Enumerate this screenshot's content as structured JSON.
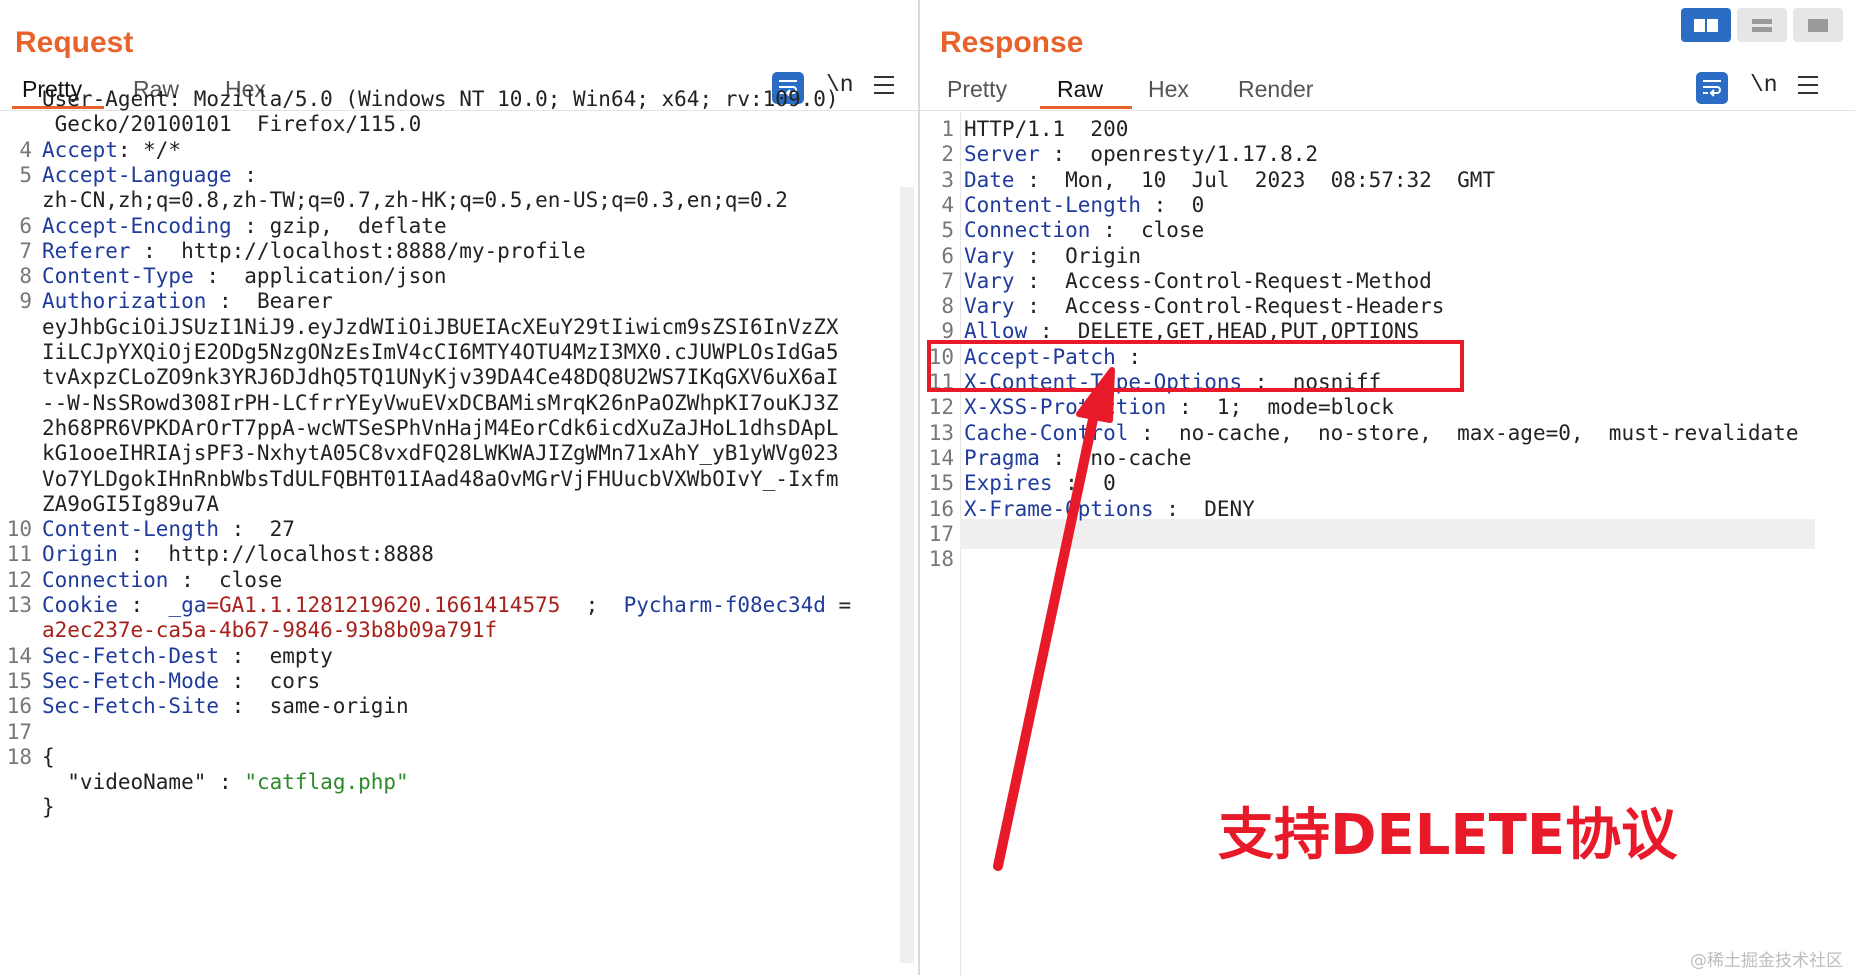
{
  "request": {
    "title": "Request",
    "tabs": [
      {
        "label": "Pretty",
        "active": true
      },
      {
        "label": "Raw",
        "active": false
      },
      {
        "label": "Hex",
        "active": false
      }
    ],
    "newline_label": "\\n",
    "lines": [
      {
        "n": "",
        "parts": [
          {
            "t": "User-Agent: Mozilla/5.0 (Windows NT 10.0; Win64; x64; rv:109.0)",
            "c": "v"
          }
        ]
      },
      {
        "n": "",
        "parts": [
          {
            "t": " Gecko/20100101  Firefox/115.0",
            "c": "v"
          }
        ]
      },
      {
        "n": "4",
        "parts": [
          {
            "t": "Accept",
            "c": "k"
          },
          {
            "t": ": */*",
            "c": "v"
          }
        ]
      },
      {
        "n": "5",
        "parts": [
          {
            "t": "Accept-Language",
            "c": "k"
          },
          {
            "t": " :",
            "c": "v"
          }
        ]
      },
      {
        "n": "",
        "parts": [
          {
            "t": "zh-CN,zh;q=0.8,zh-TW;q=0.7,zh-HK;q=0.5,en-US;q=0.3,en;q=0.2",
            "c": "v"
          }
        ]
      },
      {
        "n": "6",
        "parts": [
          {
            "t": "Accept-Encoding",
            "c": "k"
          },
          {
            "t": " : gzip,  deflate",
            "c": "v"
          }
        ]
      },
      {
        "n": "7",
        "parts": [
          {
            "t": "Referer",
            "c": "k"
          },
          {
            "t": " :  http://localhost:8888/my-profile",
            "c": "v"
          }
        ]
      },
      {
        "n": "8",
        "parts": [
          {
            "t": "Content-Type",
            "c": "k"
          },
          {
            "t": " :  application/json",
            "c": "v"
          }
        ]
      },
      {
        "n": "9",
        "parts": [
          {
            "t": "Authorization",
            "c": "k"
          },
          {
            "t": " :  Bearer",
            "c": "v"
          }
        ]
      },
      {
        "n": "",
        "parts": [
          {
            "t": "eyJhbGciOiJSUzI1NiJ9.eyJzdWIiOiJBUEIAcXEuY29tIiwicm9sZSI6InVzZX",
            "c": "v"
          }
        ]
      },
      {
        "n": "",
        "parts": [
          {
            "t": "IiLCJpYXQiOjE2ODg5NzgONzEsImV4cCI6MTY4OTU4MzI3MX0.cJUWPLOsIdGa5",
            "c": "v"
          }
        ]
      },
      {
        "n": "",
        "parts": [
          {
            "t": "tvAxpzCLoZO9nk3YRJ6DJdhQ5TQ1UNyKjv39DA4Ce48DQ8U2WS7IKqGXV6uX6aI",
            "c": "v"
          }
        ]
      },
      {
        "n": "",
        "parts": [
          {
            "t": "--W-NsSRowd308IrPH-LCfrrYEyVwuEVxDCBAMisMrqK26nPaOZWhpKI7ouKJ3Z",
            "c": "v"
          }
        ]
      },
      {
        "n": "",
        "parts": [
          {
            "t": "2h68PR6VPKDArOrT7ppA-wcWTSeSPhVnHajM4EorCdk6icdXuZaJHoL1dhsDApL",
            "c": "v"
          }
        ]
      },
      {
        "n": "",
        "parts": [
          {
            "t": "kG1ooeIHRIAjsPF3-NxhytA05C8vxdFQ28LWKWAJIZgWMn71xAhY_yB1yWVg023",
            "c": "v"
          }
        ]
      },
      {
        "n": "",
        "parts": [
          {
            "t": "Vo7YLDgokIHnRnbWbsTdULFQBHT01IAad48aOvMGrVjFHUucbVXWbOIvY_-Ixfm",
            "c": "v"
          }
        ]
      },
      {
        "n": "",
        "parts": [
          {
            "t": "ZA9oGI5Ig89u7A",
            "c": "v"
          }
        ]
      },
      {
        "n": "10",
        "parts": [
          {
            "t": "Content-Length",
            "c": "k"
          },
          {
            "t": " :  27",
            "c": "v"
          }
        ]
      },
      {
        "n": "11",
        "parts": [
          {
            "t": "Origin",
            "c": "k"
          },
          {
            "t": " :  http://localhost:8888",
            "c": "v"
          }
        ]
      },
      {
        "n": "12",
        "parts": [
          {
            "t": "Connection",
            "c": "k"
          },
          {
            "t": " :  close",
            "c": "v"
          }
        ]
      },
      {
        "n": "13",
        "parts": [
          {
            "t": "Cookie",
            "c": "k"
          },
          {
            "t": " :  ",
            "c": "v"
          },
          {
            "t": "_ga",
            "c": "k"
          },
          {
            "t": "=GA1.1.1281219620.1661414575",
            "c": "cookie-val"
          },
          {
            "t": "  ;  ",
            "c": "v"
          },
          {
            "t": "Pycharm-f08ec34d",
            "c": "k"
          },
          {
            "t": " =",
            "c": "v"
          }
        ]
      },
      {
        "n": "",
        "parts": [
          {
            "t": "a2ec237e-ca5a-4b67-9846-93b8b09a791f",
            "c": "cookie-val"
          }
        ]
      },
      {
        "n": "14",
        "parts": [
          {
            "t": "Sec-Fetch-Dest",
            "c": "k"
          },
          {
            "t": " :  empty",
            "c": "v"
          }
        ]
      },
      {
        "n": "15",
        "parts": [
          {
            "t": "Sec-Fetch-Mode",
            "c": "k"
          },
          {
            "t": " :  cors",
            "c": "v"
          }
        ]
      },
      {
        "n": "16",
        "parts": [
          {
            "t": "Sec-Fetch-Site",
            "c": "k"
          },
          {
            "t": " :  same-origin",
            "c": "v"
          }
        ]
      },
      {
        "n": "17",
        "parts": []
      },
      {
        "n": "18",
        "parts": [
          {
            "t": "{",
            "c": "v"
          }
        ]
      },
      {
        "n": "",
        "parts": [
          {
            "t": "  \"videoName\"",
            "c": "json-key"
          },
          {
            "t": " : ",
            "c": "v"
          },
          {
            "t": "\"catflag.php\"",
            "c": "json-str"
          }
        ]
      },
      {
        "n": "",
        "parts": [
          {
            "t": "}",
            "c": "v"
          }
        ]
      }
    ]
  },
  "response": {
    "title": "Response",
    "tabs": [
      {
        "label": "Pretty",
        "active": false
      },
      {
        "label": "Raw",
        "active": true
      },
      {
        "label": "Hex",
        "active": false
      },
      {
        "label": "Render",
        "active": false
      }
    ],
    "newline_label": "\\n",
    "lines": [
      {
        "n": "1",
        "parts": [
          {
            "t": "HTTP/1.1  200",
            "c": "v"
          }
        ]
      },
      {
        "n": "2",
        "parts": [
          {
            "t": "Server",
            "c": "k"
          },
          {
            "t": " :  openresty/1.17.8.2",
            "c": "v"
          }
        ]
      },
      {
        "n": "3",
        "parts": [
          {
            "t": "Date",
            "c": "k"
          },
          {
            "t": " :  Mon,  10  Jul  2023  08:57:32  GMT",
            "c": "v"
          }
        ]
      },
      {
        "n": "4",
        "parts": [
          {
            "t": "Content-Length",
            "c": "k"
          },
          {
            "t": " :  0",
            "c": "v"
          }
        ]
      },
      {
        "n": "5",
        "parts": [
          {
            "t": "Connection",
            "c": "k"
          },
          {
            "t": " :  close",
            "c": "v"
          }
        ]
      },
      {
        "n": "6",
        "parts": [
          {
            "t": "Vary",
            "c": "k"
          },
          {
            "t": " :  Origin",
            "c": "v"
          }
        ]
      },
      {
        "n": "7",
        "parts": [
          {
            "t": "Vary",
            "c": "k"
          },
          {
            "t": " :  Access-Control-Request-Method",
            "c": "v"
          }
        ]
      },
      {
        "n": "8",
        "parts": [
          {
            "t": "Vary",
            "c": "k"
          },
          {
            "t": " :  Access-Control-Request-Headers",
            "c": "v"
          }
        ]
      },
      {
        "n": "9",
        "parts": [
          {
            "t": "Allow",
            "c": "k"
          },
          {
            "t": " :  DELETE,GET,HEAD,PUT,OPTIONS",
            "c": "v"
          }
        ]
      },
      {
        "n": "10",
        "parts": [
          {
            "t": "Accept-Patch",
            "c": "k"
          },
          {
            "t": " :",
            "c": "v"
          }
        ]
      },
      {
        "n": "11",
        "parts": [
          {
            "t": "X-Content-Type-Options",
            "c": "k"
          },
          {
            "t": " :  nosniff",
            "c": "v"
          }
        ]
      },
      {
        "n": "12",
        "parts": [
          {
            "t": "X-XSS-Protection",
            "c": "k"
          },
          {
            "t": " :  1;  mode=block",
            "c": "v"
          }
        ]
      },
      {
        "n": "13",
        "parts": [
          {
            "t": "Cache-Control",
            "c": "k"
          },
          {
            "t": " :  no-cache,  no-store,  max-age=0,  must-revalidate",
            "c": "v"
          }
        ]
      },
      {
        "n": "14",
        "parts": [
          {
            "t": "Pragma",
            "c": "k"
          },
          {
            "t": " :  no-cache",
            "c": "v"
          }
        ]
      },
      {
        "n": "15",
        "parts": [
          {
            "t": "Expires",
            "c": "k"
          },
          {
            "t": " :  0",
            "c": "v"
          }
        ]
      },
      {
        "n": "16",
        "parts": [
          {
            "t": "X-Frame-Options",
            "c": "k"
          },
          {
            "t": " :  DENY",
            "c": "v"
          }
        ]
      },
      {
        "n": "17",
        "parts": []
      },
      {
        "n": "18",
        "parts": []
      }
    ]
  },
  "annotation": {
    "text": "支持DELETE协议",
    "color": "#e81a2a"
  },
  "watermark": "@稀土掘金技术社区",
  "colors": {
    "accent": "#e8632b",
    "header_key": "#1f3b9c",
    "cookie_value": "#a8201a",
    "json_string": "#2a8a2a",
    "button_blue": "#2b6cc4"
  },
  "icons": {
    "wrap": "word-wrap-icon",
    "menu": "hamburger-menu-icon",
    "layout_split": "split-view-icon",
    "layout_horizontal": "horizontal-view-icon",
    "layout_single": "single-view-icon"
  }
}
